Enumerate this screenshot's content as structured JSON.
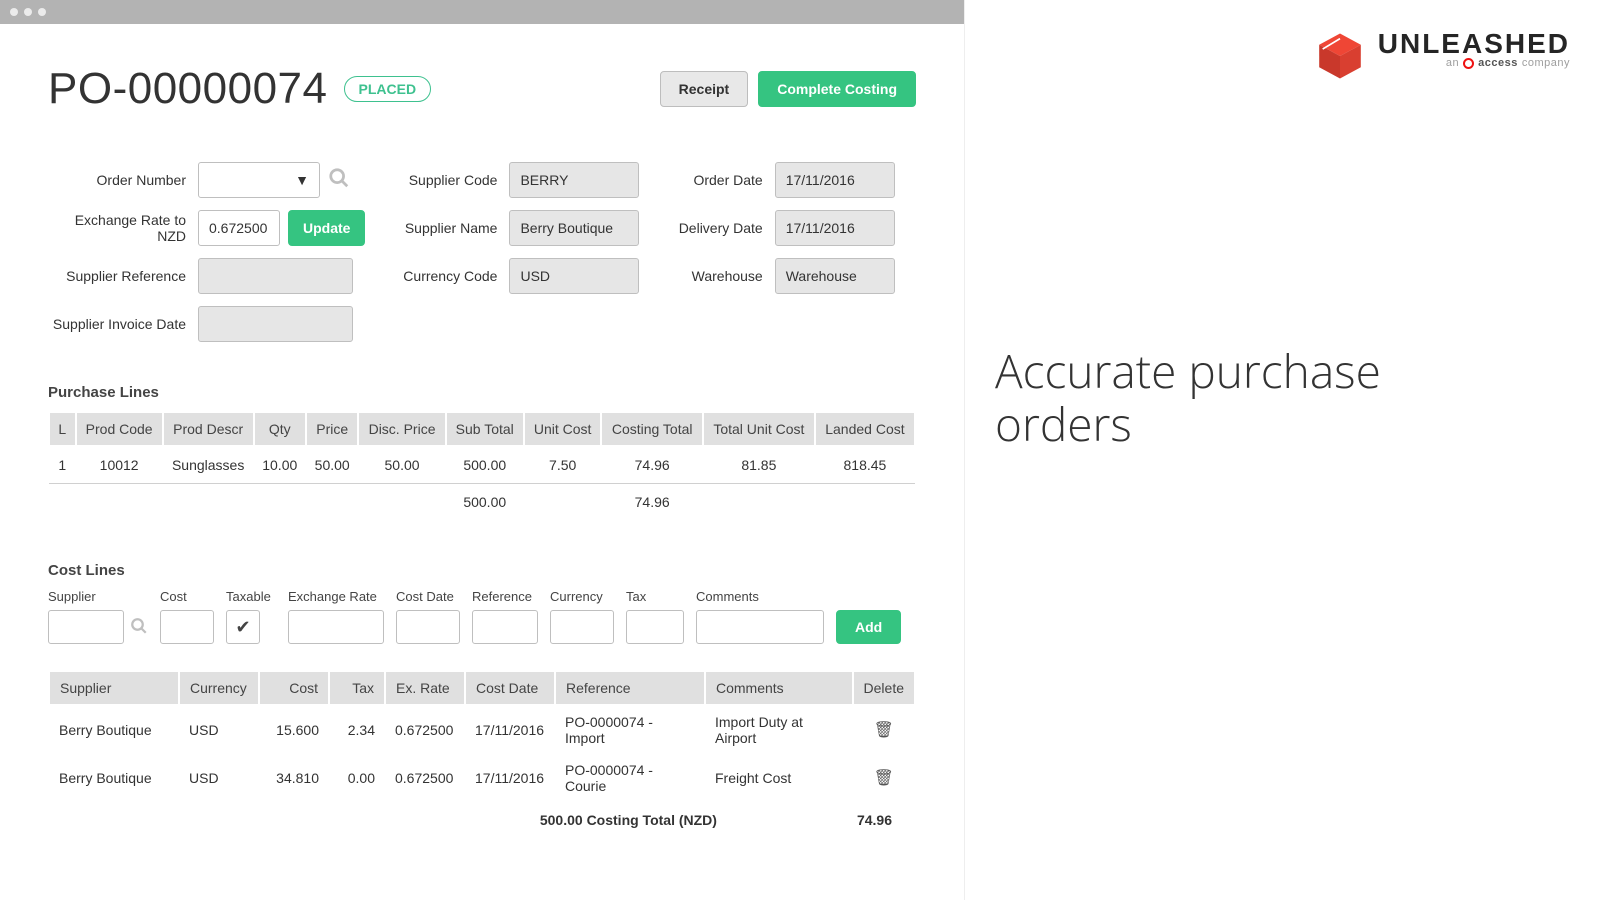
{
  "page": {
    "po_number": "PO-00000074",
    "status": "PLACED",
    "buttons": {
      "receipt": "Receipt",
      "complete": "Complete Costing",
      "update": "Update",
      "add": "Add"
    }
  },
  "fields": {
    "labels": {
      "order_number": "Order Number",
      "exchange_rate": "Exchange Rate to NZD",
      "supplier_reference": "Supplier Reference",
      "supplier_invoice_date": "Supplier Invoice Date",
      "supplier_code": "Supplier Code",
      "supplier_name": "Supplier Name",
      "currency_code": "Currency Code",
      "order_date": "Order Date",
      "delivery_date": "Delivery Date",
      "warehouse": "Warehouse"
    },
    "values": {
      "order_number": "",
      "exchange_rate": "0.672500",
      "supplier_reference": "",
      "supplier_invoice_date": "",
      "supplier_code": "BERRY",
      "supplier_name": "Berry Boutique",
      "currency_code": "USD",
      "order_date": "17/11/2016",
      "delivery_date": "17/11/2016",
      "warehouse": "Warehouse"
    }
  },
  "purchase_lines": {
    "title": "Purchase Lines",
    "headers": {
      "l": "L",
      "code": "Prod Code",
      "descr": "Prod Descr",
      "qty": "Qty",
      "price": "Price",
      "disc": "Disc. Price",
      "sub": "Sub Total",
      "unit": "Unit Cost",
      "ctotal": "Costing Total",
      "tuc": "Total Unit Cost",
      "landed": "Landed Cost"
    },
    "rows": [
      {
        "l": "1",
        "code": "10012",
        "descr": "Sunglasses",
        "qty": "10.00",
        "price": "50.00",
        "disc": "50.00",
        "sub": "500.00",
        "unit": "7.50",
        "ctotal": "74.96",
        "tuc": "81.85",
        "landed": "818.45"
      }
    ],
    "totals": {
      "sub": "500.00",
      "ctotal": "74.96"
    }
  },
  "cost_lines": {
    "title": "Cost Lines",
    "form_labels": {
      "supplier": "Supplier",
      "cost": "Cost",
      "taxable": "Taxable",
      "exrate": "Exchange Rate",
      "cdate": "Cost Date",
      "ref": "Reference",
      "curr": "Currency",
      "tax": "Tax",
      "comm": "Comments"
    },
    "table_headers": {
      "supplier": "Supplier",
      "currency": "Currency",
      "cost": "Cost",
      "tax": "Tax",
      "exrate": "Ex. Rate",
      "cdate": "Cost Date",
      "ref": "Reference",
      "comm": "Comments",
      "del": "Delete"
    },
    "rows": [
      {
        "supplier": "Berry Boutique",
        "currency": "USD",
        "cost": "15.600",
        "tax": "2.34",
        "exrate": "0.672500",
        "cdate": "17/11/2016",
        "ref": "PO-0000074 - Import",
        "comm": "Import Duty at Airport"
      },
      {
        "supplier": "Berry Boutique",
        "currency": "USD",
        "cost": "34.810",
        "tax": "0.00",
        "exrate": "0.672500",
        "cdate": "17/11/2016",
        "ref": "PO-0000074 - Courie",
        "comm": "Freight Cost"
      }
    ],
    "footer": {
      "sub": "500.00",
      "label": "Costing Total (NZD)",
      "total": "74.96"
    }
  },
  "brand": {
    "name": "UNLEASHED",
    "tag1": "an",
    "tag2": "access",
    "tag3": "company"
  },
  "promo": {
    "line1": "Accurate purchase",
    "line2": "orders"
  }
}
